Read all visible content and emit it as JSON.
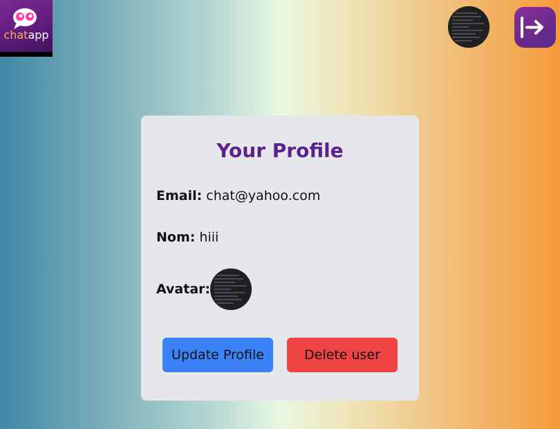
{
  "logo": {
    "text_part1": "chat",
    "text_part2": "app"
  },
  "header": {
    "avatar_alt": "user avatar",
    "logout_icon": "logout-arrow-icon"
  },
  "profile": {
    "title": "Your Profile",
    "email_label": "Email:",
    "email_value": "chat@yahoo.com",
    "name_label": "Nom:",
    "name_value": "hiii",
    "avatar_label": "Avatar:"
  },
  "actions": {
    "update_label": "Update Profile",
    "delete_label": "Delete user"
  },
  "colors": {
    "title": "#5b238a",
    "update_button": "#3b82f6",
    "delete_button": "#ef4444",
    "card_bg": "#e5e7eb",
    "logout_button": "#7a2a92"
  }
}
